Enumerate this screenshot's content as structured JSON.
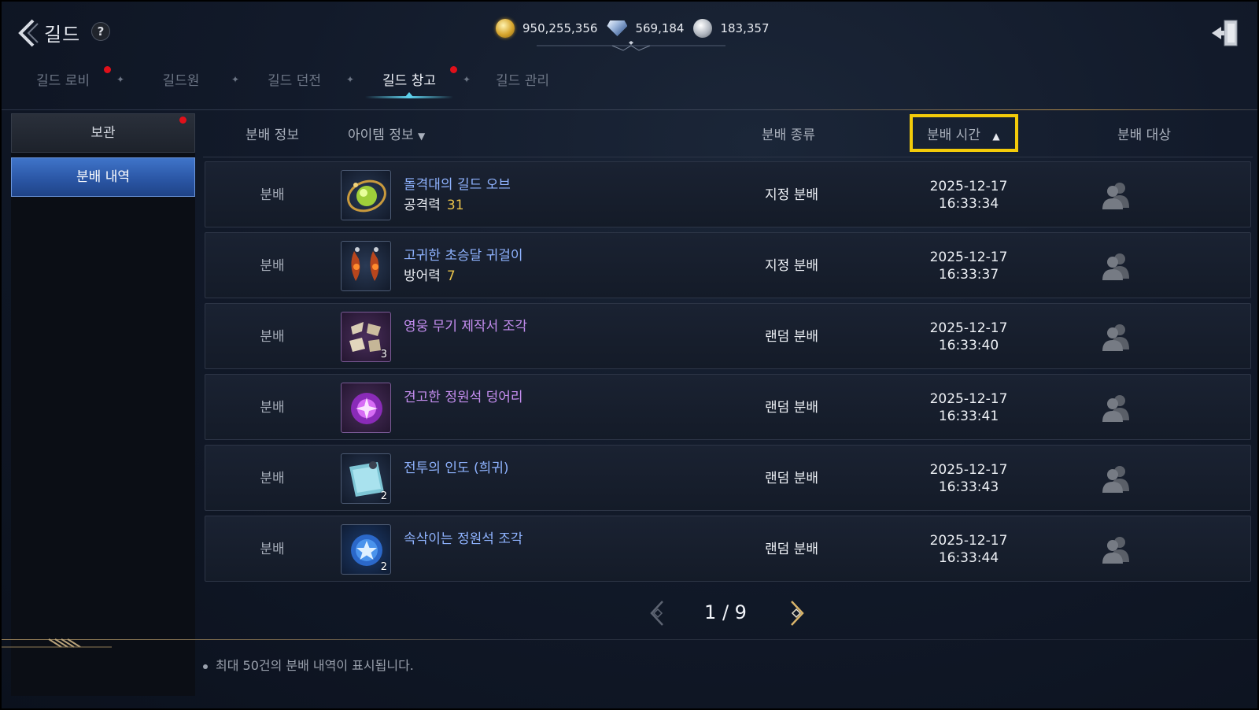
{
  "header": {
    "title": "길드",
    "help_label": "?",
    "currencies": [
      {
        "name": "gold-coin",
        "value": "950,255,356"
      },
      {
        "name": "diamond",
        "value": "569,184"
      },
      {
        "name": "silver-coin",
        "value": "183,357"
      }
    ]
  },
  "tabs": [
    {
      "label": "길드 로비",
      "active": false,
      "notification": true
    },
    {
      "label": "길드원",
      "active": false,
      "notification": false
    },
    {
      "label": "길드 던전",
      "active": false,
      "notification": false
    },
    {
      "label": "길드 창고",
      "active": true,
      "notification": true
    },
    {
      "label": "길드 관리",
      "active": false,
      "notification": false
    }
  ],
  "sidebar": {
    "items": [
      {
        "label": "보관",
        "active": false,
        "notification": true
      },
      {
        "label": "분배 내역",
        "active": true,
        "notification": false
      }
    ]
  },
  "table": {
    "columns": {
      "dist_info": "분배 정보",
      "item_info": "아이템 정보",
      "dist_type": "분배 종류",
      "dist_time": "분배 시간",
      "dist_target": "분배 대상"
    },
    "item_info_sort_icon": "▼",
    "dist_time_sort_icon": "▲",
    "rows": [
      {
        "type": "분배",
        "icon": "orb-icon",
        "name": "돌격대의 길드 오브",
        "name_color": "#8fb3ff",
        "stat_label": "공격력",
        "stat_value": "31",
        "qty": "",
        "kind": "지정 분배",
        "date": "2025-12-17",
        "time": "16:33:34"
      },
      {
        "type": "분배",
        "icon": "earring-icon",
        "name": "고귀한 초승달 귀걸이",
        "name_color": "#8fb3ff",
        "stat_label": "방어력",
        "stat_value": "7",
        "qty": "",
        "kind": "지정 분배",
        "date": "2025-12-17",
        "time": "16:33:37"
      },
      {
        "type": "분배",
        "icon": "scroll-fragment-icon",
        "name": "영웅 무기 제작서 조각",
        "name_color": "#c58ef0",
        "stat_label": "",
        "stat_value": "",
        "qty": "3",
        "kind": "랜덤 분배",
        "date": "2025-12-17",
        "time": "16:33:40"
      },
      {
        "type": "분배",
        "icon": "essence-stone-icon",
        "name": "견고한 정원석 덩어리",
        "name_color": "#c58ef0",
        "stat_label": "",
        "stat_value": "",
        "qty": "",
        "kind": "랜덤 분배",
        "date": "2025-12-17",
        "time": "16:33:41"
      },
      {
        "type": "분배",
        "icon": "battle-guide-icon",
        "name": "전투의 인도 (희귀)",
        "name_color": "#8fb3ff",
        "stat_label": "",
        "stat_value": "",
        "qty": "2",
        "kind": "랜덤 분배",
        "date": "2025-12-17",
        "time": "16:33:43"
      },
      {
        "type": "분배",
        "icon": "star-fragment-icon",
        "name": "속삭이는 정원석 조각",
        "name_color": "#8fb3ff",
        "stat_label": "",
        "stat_value": "",
        "qty": "2",
        "kind": "랜덤 분배",
        "date": "2025-12-17",
        "time": "16:33:44"
      }
    ]
  },
  "pagination": {
    "label": "1 / 9",
    "current": 1,
    "total": 9
  },
  "footer": {
    "note": "최대 50건의 분배 내역이 표시됩니다."
  }
}
